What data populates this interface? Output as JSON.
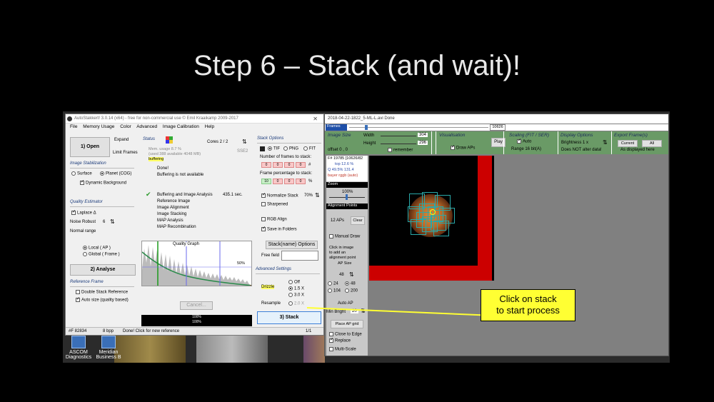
{
  "slide": {
    "title": "Step 6 – Stack (and wait)!"
  },
  "desktop": {
    "icons": [
      {
        "label": "ASCOM Diagnostics",
        "line1": "ASCOM",
        "line2": "Diagnostics"
      },
      {
        "label": "Meridian Business",
        "line1": "Meridian",
        "line2": "Business B"
      }
    ]
  },
  "autostakkert": {
    "title": "AutoStakkert! 3.0.14 (x64) - free for non-commercial use © Emil Kraaikamp 2009-2017",
    "menu": [
      "File",
      "Memory Usage",
      "Color",
      "Advanced",
      "Image Calibration",
      "Help"
    ],
    "open_button": "1) Open",
    "expand": "Expand",
    "limit_frames": "Limit Frames",
    "status_header": "Status",
    "cores": "Cores 2 / 2",
    "sse2": "SSE2",
    "mem_usage": "Mem. usage 8.7 %",
    "mem_used": "(used 388 available 4048 MB)",
    "buffering": "buffering",
    "done": "Done!",
    "buffering_na": "Buffering is not available",
    "analysis_line": "Buffering and Image Analysis",
    "analysis_time": "435.1 sec.",
    "steps": [
      "Reference Image",
      "Image Alignment",
      "Image Stacking",
      "MAP Analysis",
      "MAP Recombination"
    ],
    "image_stabilization": "Image Stabilization",
    "surface": "Surface",
    "planet_cog": "Planet (COG)",
    "dynamic_background": "Dynamic Background",
    "quality_estimator": "Quality Estimator",
    "laplace": "Laplace Δ",
    "noise_robust_label": "Noise Robust",
    "noise_robust_value": "6",
    "normal_range": "Normal range",
    "local_ap": "Local    ( AP )",
    "global_frame": "Global    ( Frame )",
    "analyse_button": "2) Analyse",
    "reference_frame": "Reference Frame",
    "double_stack": "Double Stack Reference",
    "auto_size": "Auto size (quality based)",
    "quality_graph": "Quality Graph",
    "graph_pct": "50%",
    "cancel": "Cancel...",
    "progress1": "100%",
    "progress2": "100%",
    "stack_options": "Stack Options",
    "tif": "TIF",
    "png": "PNG",
    "fit": "FIT",
    "frames_to_stack": "Number of frames to stack:",
    "frames_vals": [
      "0",
      "0",
      "0",
      "0"
    ],
    "frames_unit": "#",
    "pct_to_stack": "Frame percentage to stack:",
    "pct_vals": [
      "10",
      "0",
      "0",
      "0"
    ],
    "pct_unit": "%",
    "normalize_stack": "Normalize Stack",
    "normalize_pct": "70%",
    "sharpened": "Sharpened",
    "rgb_align": "RGB Align",
    "save_in_folders": "Save in Folders",
    "stack_name_options": "Stack(name) Options",
    "free_field": "Free field",
    "advanced_settings": "Advanced Settings",
    "drizzle": "Drizzle",
    "drizzle_off": "Off",
    "drizzle_15": "1.5 X",
    "drizzle_30": "3.0 X",
    "resample": "Resample",
    "resample_val": "2.0 X",
    "stack_button": "3) Stack",
    "status_frame": "#F 82834",
    "status_bpp": "8 bpp",
    "status_msg": "Done! Click for new reference",
    "status_page": "1/1"
  },
  "viewer": {
    "title": "2018-04-22-1822_5-ML-L.avi  Done",
    "frames_label": "Frames",
    "frame_count": "10626",
    "image_size": "Image Size",
    "width_label": "Width",
    "width_val": "304",
    "height_label": "Height",
    "height_val": "296",
    "offset": "offset   0 , 0",
    "remember": "remember",
    "play": "Play",
    "visualization": "Visualisation",
    "draw_aps": "Draw APs",
    "scaling": "Scaling (FIT / SER)",
    "auto": "Auto",
    "range": "Range 16 bit(A)",
    "display_options": "Display Options",
    "brightness": "Brightness  1 x",
    "not_alter": "Does NOT alter data!",
    "export_frames": "Export Frame(s)",
    "current": "Current",
    "all": "All",
    "as_displayed": "As displayed here",
    "frame_info1": "F# 19785 [10626/82",
    "frame_info2": "top 12.6 %",
    "frame_info3": "Q 49.5%  131.4",
    "frame_info4": "bayer rggb (auto)",
    "zoom": "Zoom",
    "zoom_val": "100%",
    "alignment_points": "Alignment Points",
    "aps_count": "12 APs",
    "clear": "Clear",
    "manual_draw": "Manual Draw",
    "instructions": [
      "Click in image",
      "to add an",
      "alignment point"
    ],
    "ap_size": "AP Size",
    "ap_size_val": "48",
    "ap_24": "24",
    "ap_48": "48",
    "ap_104": "104",
    "ap_200": "200",
    "auto_ap": "Auto AP",
    "min_bright": "Min Bright",
    "min_bright_val": "20",
    "place_ap_grid": "Place AP grid",
    "close_to_edge": "Close to Edge",
    "replace": "Replace",
    "multi_scale": "Multi-Scale"
  },
  "callout": {
    "line1": "Click on stack",
    "line2": "to start process"
  },
  "colors": {
    "callout_bg": "#ffff33",
    "top_panel": "#6a9a66",
    "red_frame": "#cc0000"
  }
}
